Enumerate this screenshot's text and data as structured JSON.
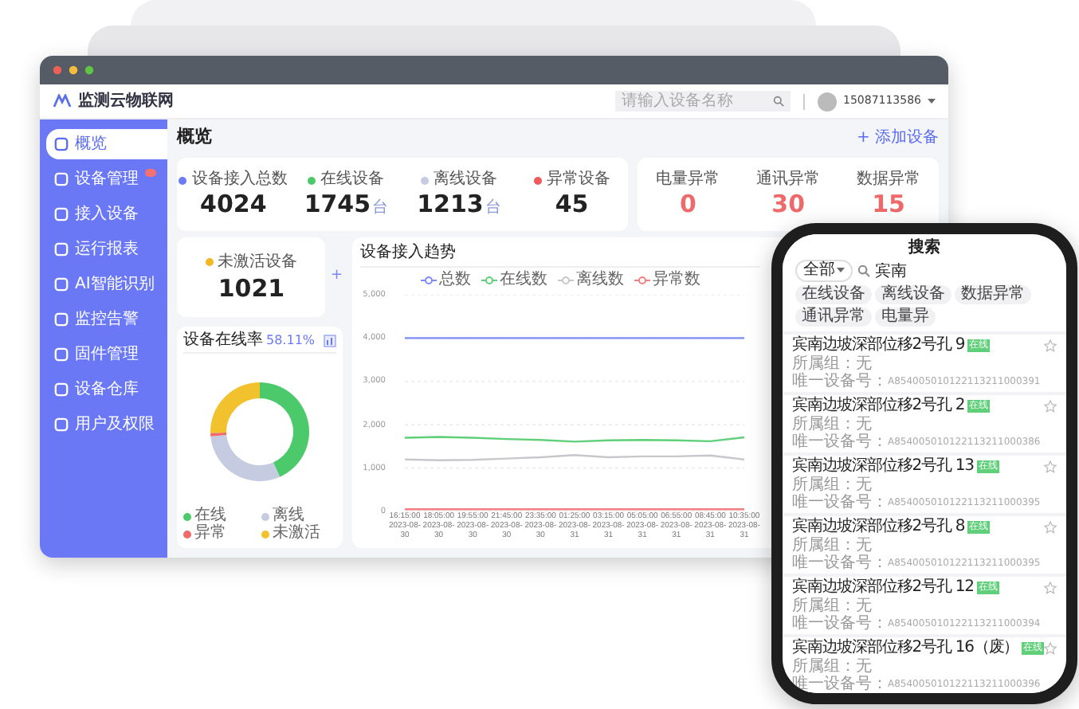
{
  "app": {
    "logo_text": "监测云物联网",
    "search": {
      "placeholder": "请输入设备名称"
    },
    "user": "15087113586"
  },
  "sidebar": {
    "items": [
      {
        "label": "概览",
        "selected": true,
        "badge": false
      },
      {
        "label": "设备管理",
        "selected": false,
        "badge": true
      },
      {
        "label": "接入设备",
        "selected": false,
        "badge": false
      },
      {
        "label": "运行报表",
        "selected": false,
        "badge": false
      },
      {
        "label": "AI智能识别",
        "selected": false,
        "badge": false
      },
      {
        "label": "监控告警",
        "selected": false,
        "badge": false
      },
      {
        "label": "固件管理",
        "selected": false,
        "badge": false
      },
      {
        "label": "设备仓库",
        "selected": false,
        "badge": false
      },
      {
        "label": "用户及权限",
        "selected": false,
        "badge": false
      }
    ]
  },
  "page": {
    "title": "概览",
    "add_button": "+ 添加设备"
  },
  "stats": [
    {
      "label": "设备接入总数",
      "value": "4024",
      "color": "#6b7cf6"
    },
    {
      "label": "在线设备",
      "value": "1745",
      "color": "#4cc96b",
      "unit": "台"
    },
    {
      "label": "离线设备",
      "value": "1213",
      "color": "#c5cbe0",
      "unit": "台"
    },
    {
      "label": "异常设备",
      "value": "45",
      "color": "#ef5b5b"
    }
  ],
  "alerts": [
    {
      "label": "电量异常",
      "value": "0"
    },
    {
      "label": "通讯异常",
      "value": "30"
    },
    {
      "label": "数据异常",
      "value": "15"
    }
  ],
  "inactive": {
    "label": "未激活设备",
    "value": "1021",
    "color": "#f2b824",
    "add": "+"
  },
  "online_rate": {
    "title": "设备在线率",
    "value": "58.11%",
    "chart_data": {
      "type": "donut",
      "categories": [
        "在线",
        "离线",
        "异常",
        "未激活"
      ],
      "values": [
        43.37,
        30.14,
        1.12,
        25.37
      ],
      "colors": [
        "#4cc96b",
        "#c5cbe0",
        "#ef6b6b",
        "#f2c12e"
      ]
    }
  },
  "trend": {
    "title": "设备接入趋势",
    "chart_data": {
      "type": "line",
      "categories": [
        "16:15:00 2023-08-30",
        "18:05:00 2023-08-30",
        "19:55:00 2023-08-30",
        "21:45:00 2023-08-30",
        "23:35:00 2023-08-30",
        "01:25:00 2023-08-31",
        "03:15:00 2023-08-31",
        "05:05:00 2023-08-31",
        "06:55:00 2023-08-31",
        "08:45:00 2023-08-31",
        "10:35:00 2023-08-31"
      ],
      "ylim": [
        0,
        5000
      ],
      "grid": true,
      "legend": "top",
      "yticks": [
        {
          "value": 0,
          "label": "0"
        },
        {
          "value": 1000,
          "label": "1,000"
        },
        {
          "value": 2000,
          "label": "2,000"
        },
        {
          "value": 3000,
          "label": "3,000"
        },
        {
          "value": 4000,
          "label": "4,000"
        },
        {
          "value": 5000,
          "label": "5,000"
        }
      ],
      "series": [
        {
          "name": "总数",
          "color": "#7b8cf7",
          "values": [
            4000,
            4000,
            4000,
            4000,
            4000,
            4000,
            4000,
            4000,
            4000,
            4000,
            4000
          ]
        },
        {
          "name": "在线数",
          "color": "#5fcf7a",
          "values": [
            1700,
            1720,
            1700,
            1670,
            1650,
            1610,
            1640,
            1650,
            1640,
            1620,
            1710
          ]
        },
        {
          "name": "离线数",
          "color": "#c8c8cc",
          "values": [
            1200,
            1180,
            1190,
            1220,
            1250,
            1300,
            1250,
            1270,
            1270,
            1290,
            1200
          ]
        },
        {
          "name": "异常数",
          "color": "#f08080",
          "values": [
            50,
            50,
            50,
            50,
            50,
            50,
            50,
            50,
            50,
            50,
            50
          ]
        }
      ]
    }
  },
  "phone": {
    "title": "搜索",
    "filter": "全部",
    "query": "宾南",
    "tags": [
      "在线设备",
      "离线设备",
      "数据异常",
      "通讯异常",
      "电量异"
    ],
    "devices": [
      {
        "name": "宾南边坡深部位移2号孔 9",
        "status": "在线",
        "group": "所属组：无",
        "id_label": "唯一设备号：",
        "device_id": "A854005010122113211000391",
        "starred": false
      },
      {
        "name": "宾南边坡深部位移2号孔 2",
        "status": "在线",
        "group": "所属组：无",
        "id_label": "唯一设备号：",
        "device_id": "A854005010122113211000386",
        "starred": false
      },
      {
        "name": "宾南边坡深部位移2号孔 13",
        "status": "在线",
        "group": "所属组：无",
        "id_label": "唯一设备号：",
        "device_id": "A854005010122113211000395",
        "starred": false
      },
      {
        "name": "宾南边坡深部位移2号孔 8",
        "status": "在线",
        "group": "所属组：无",
        "id_label": "唯一设备号：",
        "device_id": "A854005010122113211000395",
        "starred": false
      },
      {
        "name": "宾南边坡深部位移2号孔 12",
        "status": "在线",
        "group": "所属组：无",
        "id_label": "唯一设备号：",
        "device_id": "A854005010122113211000394",
        "starred": false
      },
      {
        "name": "宾南边坡深部位移2号孔 16（废）",
        "status": "在线",
        "group": "所属组：无",
        "id_label": "唯一设备号：",
        "device_id": "A854005010122113211000396",
        "starred": false
      }
    ]
  }
}
